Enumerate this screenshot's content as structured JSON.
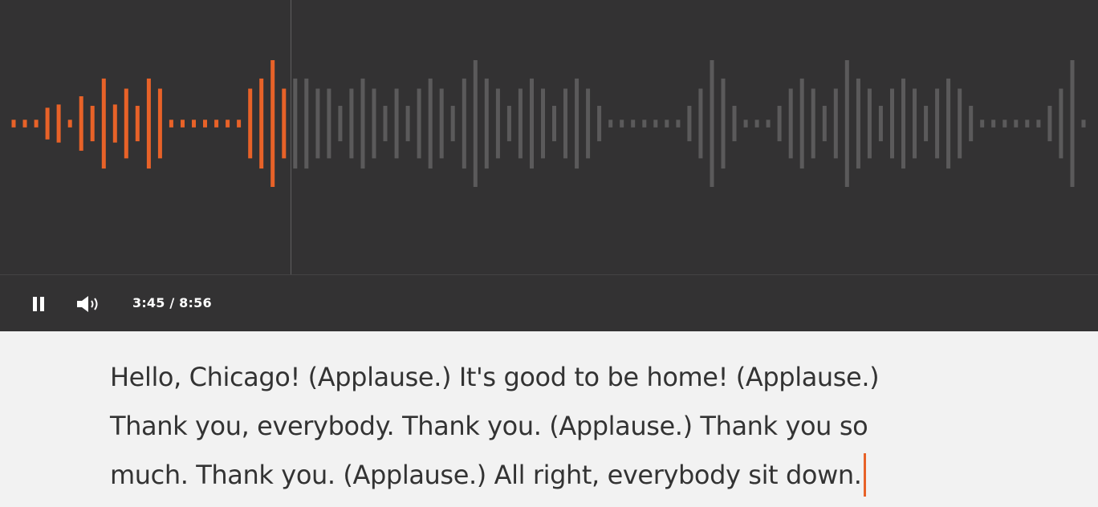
{
  "player": {
    "time_display": "3:45 / 8:56",
    "played_fraction": 0.265,
    "colors": {
      "background": "#333233",
      "played": "#e86228",
      "unplayed": "#5b5a5b",
      "playhead": "#5f5e5f"
    },
    "pause_icon": "pause-icon",
    "volume_icon": "volume-icon",
    "waveform_levels": [
      0.06,
      0.06,
      0.06,
      0.25,
      0.3,
      0.06,
      0.43,
      0.28,
      0.71,
      0.3,
      0.55,
      0.28,
      0.71,
      0.55,
      0.06,
      0.06,
      0.06,
      0.06,
      0.06,
      0.06,
      0.06,
      0.55,
      0.71,
      1.0,
      0.55,
      0.71,
      0.71,
      0.55,
      0.55,
      0.28,
      0.55,
      0.71,
      0.55,
      0.28,
      0.55,
      0.28,
      0.55,
      0.71,
      0.55,
      0.28,
      0.71,
      1.0,
      0.71,
      0.55,
      0.28,
      0.55,
      0.71,
      0.55,
      0.28,
      0.55,
      0.71,
      0.55,
      0.28,
      0.06,
      0.06,
      0.06,
      0.06,
      0.06,
      0.06,
      0.06,
      0.28,
      0.55,
      1.0,
      0.71,
      0.28,
      0.06,
      0.06,
      0.06,
      0.28,
      0.55,
      0.71,
      0.55,
      0.28,
      0.55,
      1.0,
      0.71,
      0.55,
      0.28,
      0.55,
      0.71,
      0.55,
      0.28,
      0.55,
      0.71,
      0.55,
      0.28,
      0.06,
      0.06,
      0.06,
      0.06,
      0.06,
      0.06,
      0.28,
      0.55,
      1.0,
      0.06
    ]
  },
  "transcript": {
    "lines": [
      "Hello, Chicago! (Applause.) It's good to be home! (Applause.)",
      "Thank you, everybody. Thank you. (Applause.) Thank you so",
      "much. Thank you. (Applause.) All right, everybody sit down."
    ]
  }
}
